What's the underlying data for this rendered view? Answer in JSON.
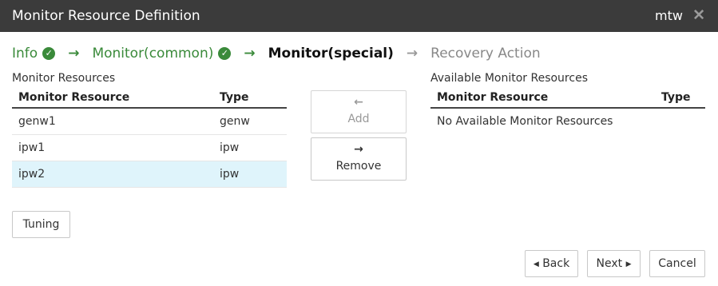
{
  "dialog": {
    "title": "Monitor Resource Definition",
    "user": "mtw",
    "close_glyph": "✕"
  },
  "steps": [
    {
      "label": "Info",
      "state": "done"
    },
    {
      "label": "Monitor(common)",
      "state": "done"
    },
    {
      "label": "Monitor(special)",
      "state": "current"
    },
    {
      "label": "Recovery Action",
      "state": "future"
    }
  ],
  "left": {
    "label": "Monitor Resources",
    "columns": [
      "Monitor Resource",
      "Type"
    ],
    "rows": [
      {
        "name": "genw1",
        "type": "genw",
        "selected": false
      },
      {
        "name": "ipw1",
        "type": "ipw",
        "selected": false
      },
      {
        "name": "ipw2",
        "type": "ipw",
        "selected": true
      }
    ]
  },
  "right": {
    "label": "Available Monitor Resources",
    "columns": [
      "Monitor Resource",
      "Type"
    ],
    "empty_text": "No Available Monitor Resources"
  },
  "buttons": {
    "add": "Add",
    "remove": "Remove",
    "tuning": "Tuning",
    "back": "Back",
    "next": "Next",
    "cancel": "Cancel"
  },
  "icons": {
    "check": "check-circle-icon",
    "step_arrow": "arrow-right-icon",
    "add": "arrow-left-icon",
    "remove": "arrow-right-icon"
  },
  "colors": {
    "titlebar": "#3b3b3b",
    "done_step": "#3a8a3a",
    "selected_row": "#dff4fb"
  }
}
